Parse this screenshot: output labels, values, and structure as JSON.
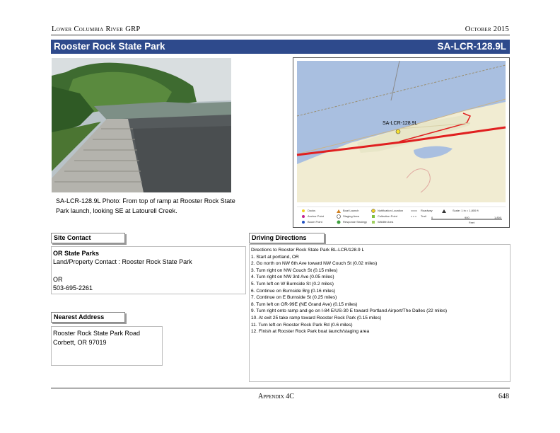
{
  "header": {
    "left": "Lower Columbia River GRP",
    "right": "October 2015"
  },
  "title": {
    "name": "Rooster Rock State Park",
    "code": "SA-LCR-128.9L"
  },
  "photo": {
    "caption": "SA-LCR-128.9L Photo: From top of ramp at Rooster Rock State Park launch, looking SE at Latourell Creek."
  },
  "map": {
    "site_label": "SA-LCR-128.9L",
    "legend": {
      "row1": [
        "Docks",
        "Boat Launch",
        "Notification Location",
        "Roadway",
        "Scale: 1 in = 1,800 ft"
      ],
      "row2": [
        "Anchor Point",
        "Staging Area",
        "Collection Point",
        "Trail"
      ],
      "row3": [
        "Boom Point",
        "Response Strategy",
        "Wildlife Area"
      ],
      "scale_labels": [
        "0",
        "900",
        "1,800"
      ],
      "scale_unit": "Feet"
    }
  },
  "site_contact": {
    "label": "Site Contact",
    "org": "OR State Parks",
    "contact_line": "Land/Property Contact : Rooster Rock State Park",
    "state": "OR",
    "phone": "503-695-2261"
  },
  "nearest_address": {
    "label": "Nearest Address",
    "line1": "Rooster Rock State  Park Road",
    "line2": "Corbett, OR  97019"
  },
  "driving_directions": {
    "label": "Driving Directions",
    "lines": [
      "Directions to Rooster Rock State Park BL-LCR/128.9 L",
      "1. Start at portland, OR",
      "2. Go north on NW 6th Ave toward NW Couch St (0.02 miles)",
      "3. Turn right on NW Couch St (0.15 miles)",
      "4. Turn right on NW 3rd Ave (0.05 miles)",
      "5. Turn left on W Burnside St (0.2 miles)",
      "6. Continue on Burnside Brg (0.16 miles)",
      "7. Continue on E Burnside St (0.25 miles)",
      "8. Turn left on OR-99E (NE Grand Ave) (0.15 miles)",
      "9. Turn right onto ramp and go on I-84 E/US-30 E toward Portland Airport/The Dalles (22 miles)",
      "10. At exit 25 take ramp toward Rooster Rock Park (0.15 miles)",
      "11. Turn left on Rooster Rock Park Rd (0.6 miles)",
      "12. Finish at Rooster Rock Park boat launch/staging area"
    ]
  },
  "footer": {
    "center": "Appendix 4C",
    "page": "648"
  }
}
